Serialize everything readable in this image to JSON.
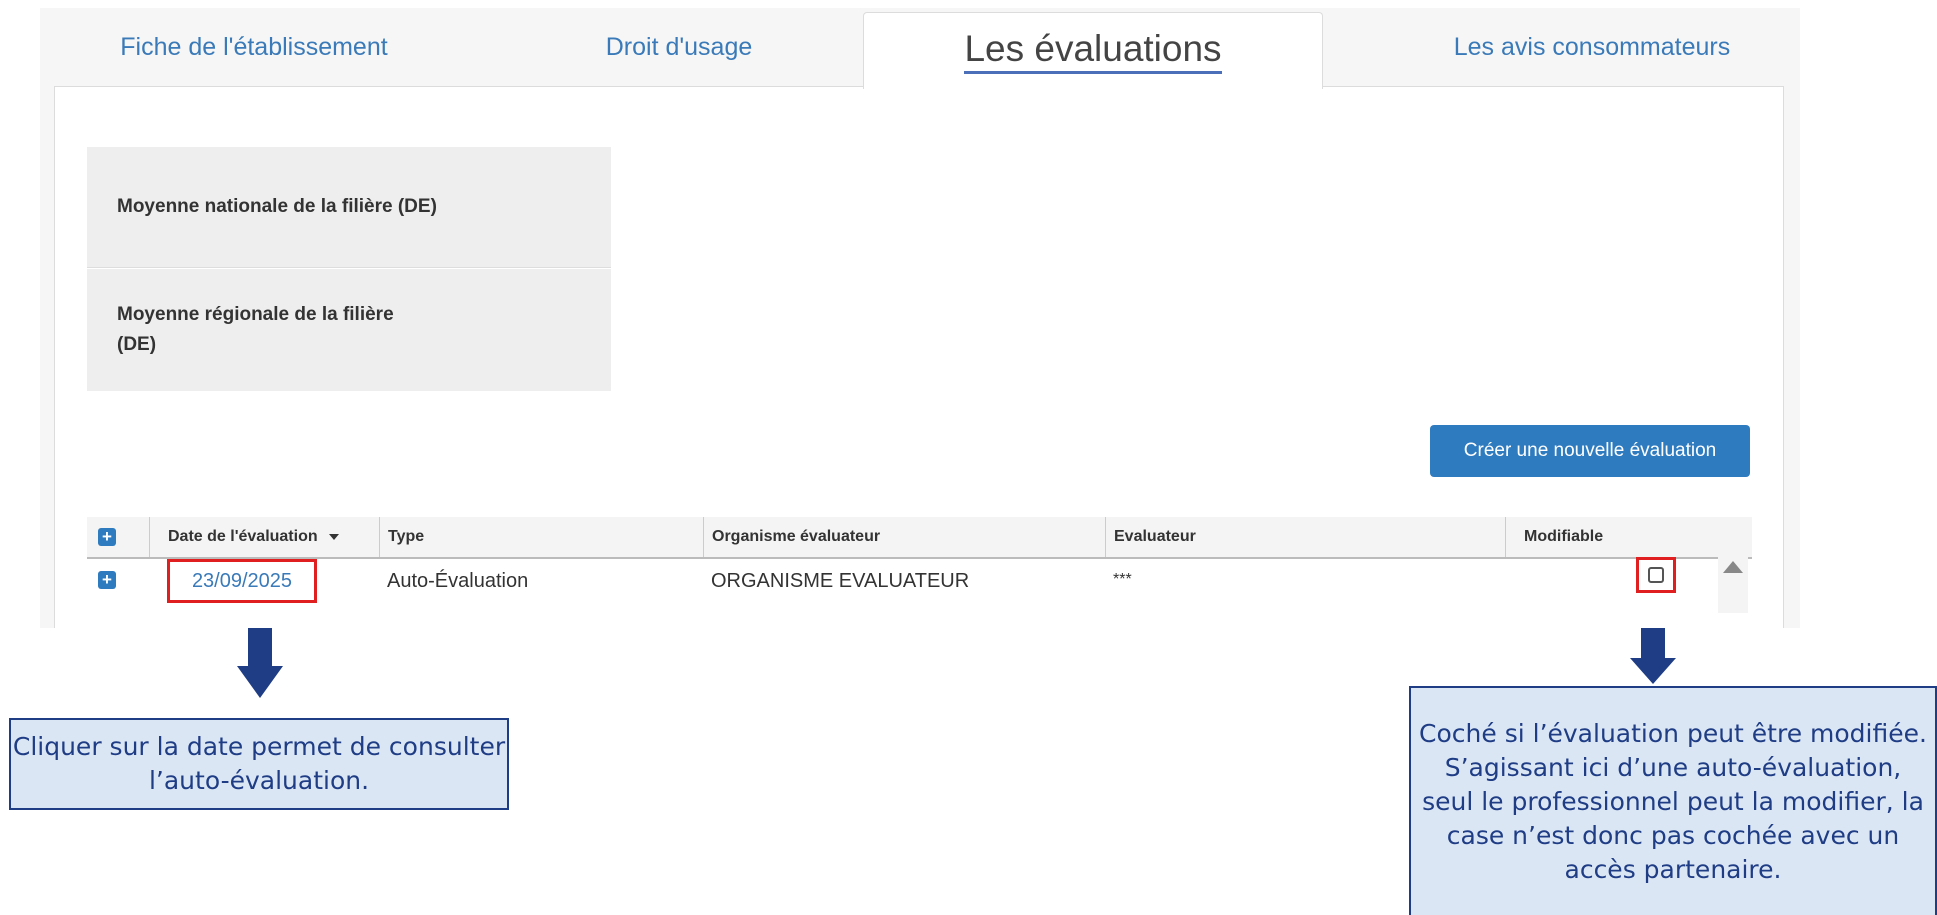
{
  "tabs": [
    {
      "label": "Fiche de l'établissement"
    },
    {
      "label": "Droit d'usage"
    },
    {
      "label": "Les évaluations"
    },
    {
      "label": "Les avis consommateurs"
    }
  ],
  "averages": {
    "national": "Moyenne nationale de la filière (DE)",
    "regional": "Moyenne régionale de la filière (DE)"
  },
  "create_button": "Créer une nouvelle évaluation",
  "grid": {
    "columns": [
      "Date de l'évaluation",
      "Type",
      "Organisme évaluateur",
      "Evaluateur",
      "Modifiable"
    ],
    "sort_icon": "caret-down-icon",
    "rows": [
      {
        "date": "23/09/2025",
        "type": "Auto-Évaluation",
        "organisme": "ORGANISME EVALUATEUR",
        "evaluateur": "***",
        "modifiable": false
      }
    ]
  },
  "annotations": {
    "date_note": "Cliquer sur la date permet de consulter l’auto-évaluation.",
    "modifiable_note": "Coché si l’évaluation peut être modifiée. S’agissant ici d’une auto-évaluation, seul le professionnel peut la modifier, la case n’est donc pas cochée avec un accès partenaire."
  },
  "colors": {
    "accent": "#2f7bbf",
    "link": "#3a7ab8",
    "highlight": "#e02020",
    "callout_border": "#1f3d85",
    "callout_bg": "#dbe6f5"
  }
}
